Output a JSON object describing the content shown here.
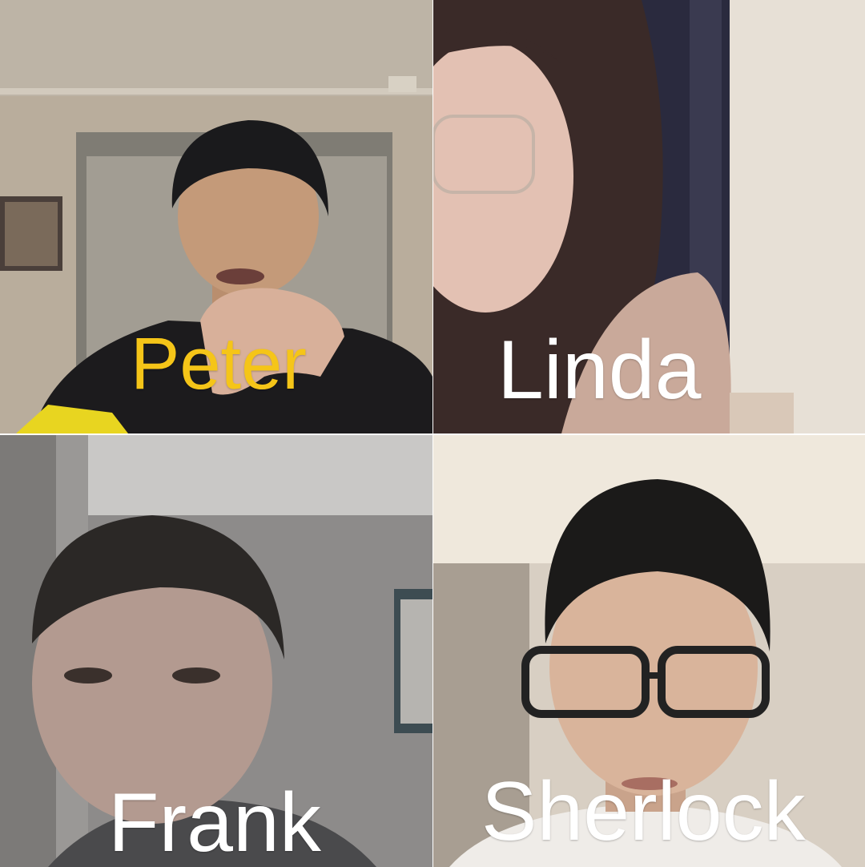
{
  "participants": [
    {
      "id": "peter",
      "name": "Peter",
      "name_color": "#f5c518"
    },
    {
      "id": "linda",
      "name": "Linda",
      "name_color": "#ffffff"
    },
    {
      "id": "frank",
      "name": "Frank",
      "name_color": "#ffffff"
    },
    {
      "id": "sherlock",
      "name": "Sherlock",
      "name_color": "#ffffff"
    }
  ]
}
